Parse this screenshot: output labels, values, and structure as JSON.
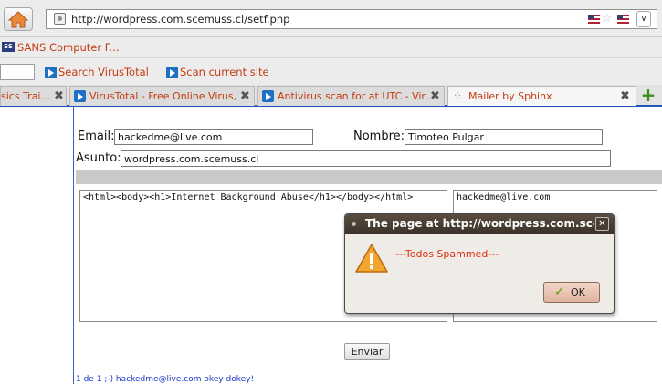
{
  "browser": {
    "url": "http://wordpress.com.scemuss.cl/setf.php",
    "bookmarks": {
      "sans": "SANS Computer F..."
    },
    "virustotal_toolbar": {
      "search_label": "Search VirusTotal",
      "scan_label": "Scan current site"
    },
    "tabs": [
      {
        "label": "sics Trai..."
      },
      {
        "label": "VirusTotal - Free Online Virus, ..."
      },
      {
        "label": "Antivirus scan for at UTC - Vir..."
      },
      {
        "label": "Mailer by Sphinx"
      }
    ]
  },
  "form": {
    "email_label": "Email:",
    "email_value": "hackedme@live.com",
    "nombre_label": "Nombre:",
    "nombre_value": "Timoteo Pulgar",
    "asunto_label": "Asunto:",
    "asunto_value": "wordpress.com.scemuss.cl",
    "body_value": "<html><body><h1>Internet Background Abuse</h1></body></html>",
    "list_value": "hackedme@live.com",
    "send_label": "Enviar",
    "status": "1 de 1 ;-) hackedme@live.com okey dokey!"
  },
  "dialog": {
    "title": "The page at http://wordpress.com.scen",
    "message": "---Todos Spammed---",
    "ok_label": "OK"
  },
  "colors": {
    "link_orange": "#c43a10",
    "tab_underline": "#2157b8",
    "status_blue": "#1c36c8",
    "alert_red": "#e02e14"
  }
}
